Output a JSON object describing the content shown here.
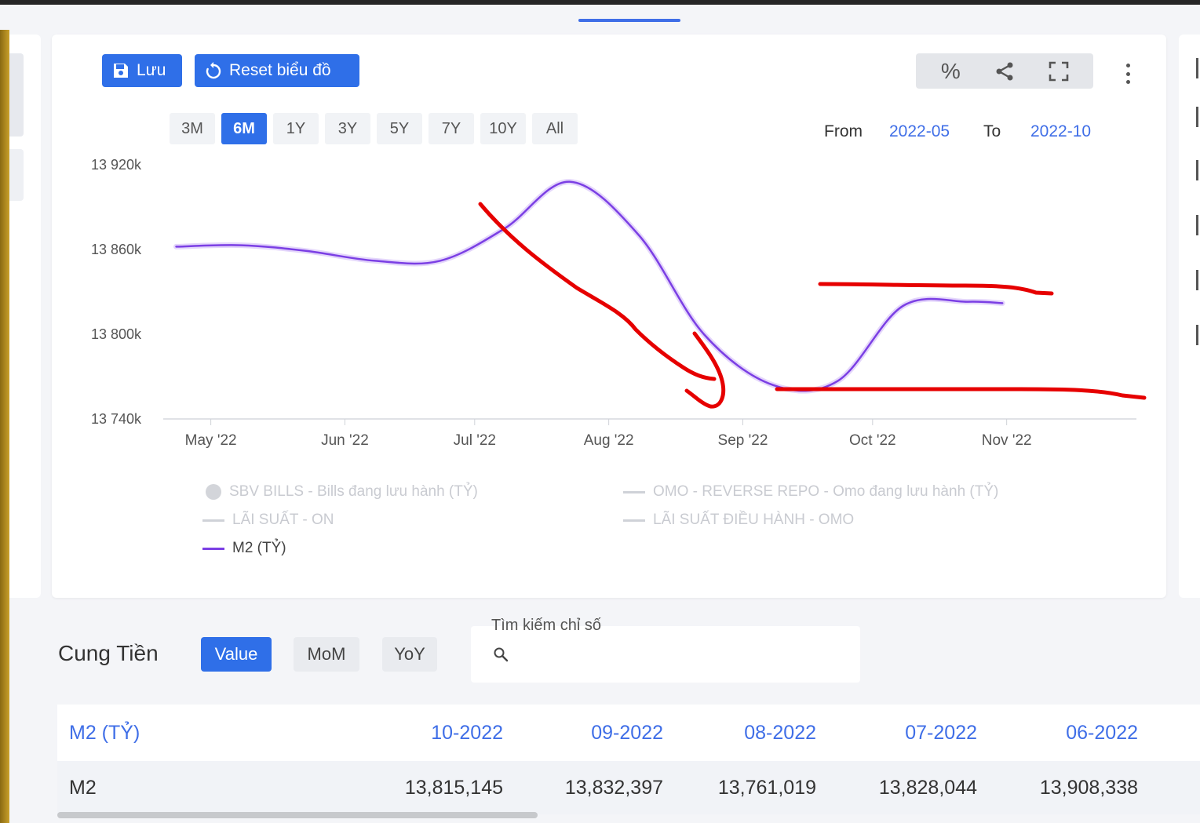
{
  "toolbar": {
    "save_label": "Lưu",
    "reset_label": "Reset biểu đồ",
    "percent_symbol": "%"
  },
  "ranges": [
    "3M",
    "6M",
    "1Y",
    "3Y",
    "5Y",
    "7Y",
    "10Y",
    "All"
  ],
  "active_range": "6M",
  "date_range": {
    "from_label": "From",
    "from_value": "2022-05",
    "to_label": "To",
    "to_value": "2022-10"
  },
  "colors": {
    "accent": "#2f6fe8",
    "series_m2": "#7b3fe4",
    "annotation": "#e60000",
    "legend_inactive": "#cfd2d8"
  },
  "chart_data": {
    "type": "line",
    "title": "",
    "xlabel": "",
    "ylabel": "",
    "x_ticks": [
      "May '22",
      "Jun '22",
      "Jul '22",
      "Aug '22",
      "Sep '22",
      "Oct '22",
      "Nov '22"
    ],
    "y_ticks": [
      "13 920k",
      "13 860k",
      "13 800k",
      "13 740k"
    ],
    "ylim": [
      13740000,
      13920000
    ],
    "grid": false,
    "legend_position": "bottom",
    "legend": [
      {
        "name": "SBV BILLS - Bills đang lưu hành (TỶ)",
        "marker": "dot",
        "active": false
      },
      {
        "name": "OMO - REVERSE REPO - Omo đang lưu hành (TỶ)",
        "marker": "line",
        "active": false
      },
      {
        "name": "LÃI SUẤT - ON",
        "marker": "line",
        "active": false
      },
      {
        "name": "LÃI SUẤT ĐIỀU HÀNH - OMO",
        "marker": "line",
        "active": false
      },
      {
        "name": "M2 (TỶ)",
        "marker": "line",
        "active": true
      }
    ],
    "series": [
      {
        "name": "M2 (TỶ)",
        "x": [
          "2022-04-23",
          "2022-05-08",
          "2022-05-23",
          "2022-06-08",
          "2022-06-23",
          "2022-07-08",
          "2022-07-23",
          "2022-08-08",
          "2022-08-23",
          "2022-09-08",
          "2022-09-23",
          "2022-10-08",
          "2022-10-23",
          "2022-10-31"
        ],
        "y": [
          13862000,
          13863000,
          13859000,
          13852000,
          13852000,
          13875000,
          13908000,
          13870000,
          13800000,
          13764000,
          13767000,
          13820000,
          13823000,
          13822000
        ]
      }
    ]
  },
  "section": {
    "title": "Cung Tiền",
    "value_label": "Value",
    "mom_label": "MoM",
    "yoy_label": "YoY",
    "search_label": "Tìm kiếm chỉ số",
    "search_placeholder": ""
  },
  "table": {
    "headers": [
      "M2 (TỶ)",
      "10-2022",
      "09-2022",
      "08-2022",
      "07-2022",
      "06-2022"
    ],
    "rows": [
      [
        "M2",
        "13,815,145",
        "13,832,397",
        "13,761,019",
        "13,828,044",
        "13,908,338"
      ]
    ]
  }
}
